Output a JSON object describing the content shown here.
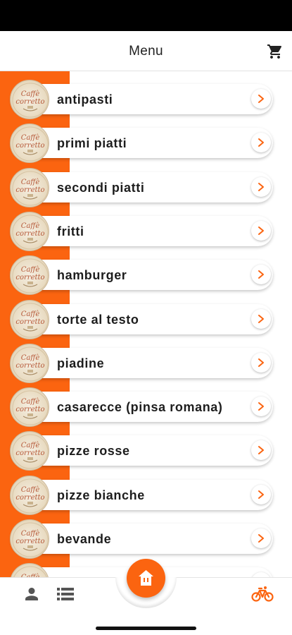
{
  "header": {
    "title": "Menu",
    "cart_icon": "cart-icon"
  },
  "theme": {
    "accent": "#fb6410",
    "background": "#ffffff",
    "text": "#1d1d1d"
  },
  "menu": {
    "logo_text_top": "Caffè",
    "logo_text_bottom": "corretto",
    "items": [
      {
        "label": "antipasti"
      },
      {
        "label": "primi piatti"
      },
      {
        "label": "secondi piatti"
      },
      {
        "label": "fritti"
      },
      {
        "label": "hamburger"
      },
      {
        "label": "torte al testo"
      },
      {
        "label": "piadine"
      },
      {
        "label": "casarecce (pinsa romana)"
      },
      {
        "label": "pizze rosse"
      },
      {
        "label": "pizze bianche"
      },
      {
        "label": "bevande"
      },
      {
        "label": ""
      }
    ]
  },
  "bottom_nav": {
    "left_icons": [
      "user-icon",
      "list-icon"
    ],
    "center_icon": "home-icon",
    "right_icon": "bike-icon"
  }
}
